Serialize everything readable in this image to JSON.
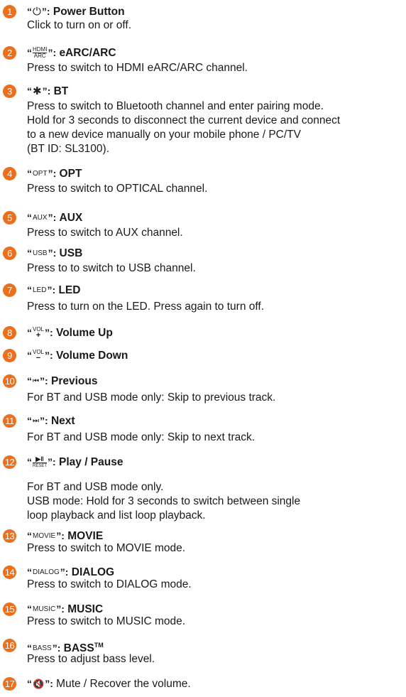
{
  "entries": [
    {
      "n": "1",
      "symbol": "⏻",
      "title": "Power Button",
      "desc": [
        "Click to turn on or off."
      ]
    },
    {
      "n": "2",
      "symbol_top": "HDMI",
      "symbol_bottom": "ARC",
      "title": "eARC/ARC",
      "desc": [
        "Press to switch to HDMI eARC/ARC channel."
      ]
    },
    {
      "n": "3",
      "symbol": "✱",
      "title": "BT",
      "desc": [
        "Press to switch to Bluetooth channel and enter pairing mode.",
        "Hold for 3 seconds to disconnect the current device and connect",
        "to a new device manually on your mobile phone / PC/TV",
        "(BT ID: SL3100)."
      ]
    },
    {
      "n": "4",
      "symbol": "OPT",
      "title": "OPT",
      "desc": [
        "Press to switch to OPTICAL channel."
      ]
    },
    {
      "n": "5",
      "symbol": "AUX",
      "title": "AUX",
      "desc": [
        "Press to switch to AUX channel."
      ]
    },
    {
      "n": "6",
      "symbol": "USB",
      "title": "USB",
      "desc": [
        "Press to to switch to USB channel."
      ]
    },
    {
      "n": "7",
      "symbol": "LED",
      "title": "LED",
      "desc": [
        "Press to turn on the LED. Press again to turn off."
      ]
    },
    {
      "n": "8",
      "symbol_top": "VOL",
      "symbol_bottom": "+",
      "title": "Volume Up",
      "desc": []
    },
    {
      "n": "9",
      "symbol_top": "VOL",
      "symbol_bottom": "−",
      "title": "Volume Down",
      "desc": []
    },
    {
      "n": "10",
      "symbol": "⏮",
      "title": "Previous",
      "desc": [
        "For BT and USB mode only: Skip to previous track."
      ]
    },
    {
      "n": "11",
      "symbol": "⏭",
      "title": "Next",
      "desc": [
        "For BT and USB mode only: Skip to next track."
      ]
    },
    {
      "n": "12",
      "symbol_top": "▶‖",
      "symbol_bottom": "RESET",
      "title": "Play / Pause",
      "desc": [
        "For BT and USB mode only.",
        "USB mode: Hold for 3 seconds to switch between single",
        "loop playback and list loop playback."
      ]
    },
    {
      "n": "13",
      "symbol": "MOVIE",
      "title": "MOVIE",
      "desc": [
        "Press to switch to MOVIE mode."
      ]
    },
    {
      "n": "14",
      "symbol": "DIALOG",
      "title": "DIALOG",
      "desc": [
        "Press to switch to DIALOG mode."
      ]
    },
    {
      "n": "15",
      "symbol": "MUSIC",
      "title": "MUSIC",
      "desc": [
        "Press to switch to MUSIC mode."
      ]
    },
    {
      "n": "16",
      "symbol": "BASS",
      "title": "BASS",
      "title_sup": "TM",
      "desc": [
        "Press to adjust bass level."
      ]
    },
    {
      "n": "17",
      "symbol": "🔇",
      "title": "Mute / Recover the volume.",
      "desc": []
    }
  ],
  "quote_open": "“",
  "quote_close": "”:",
  "badge_color": "#ec6f1b"
}
